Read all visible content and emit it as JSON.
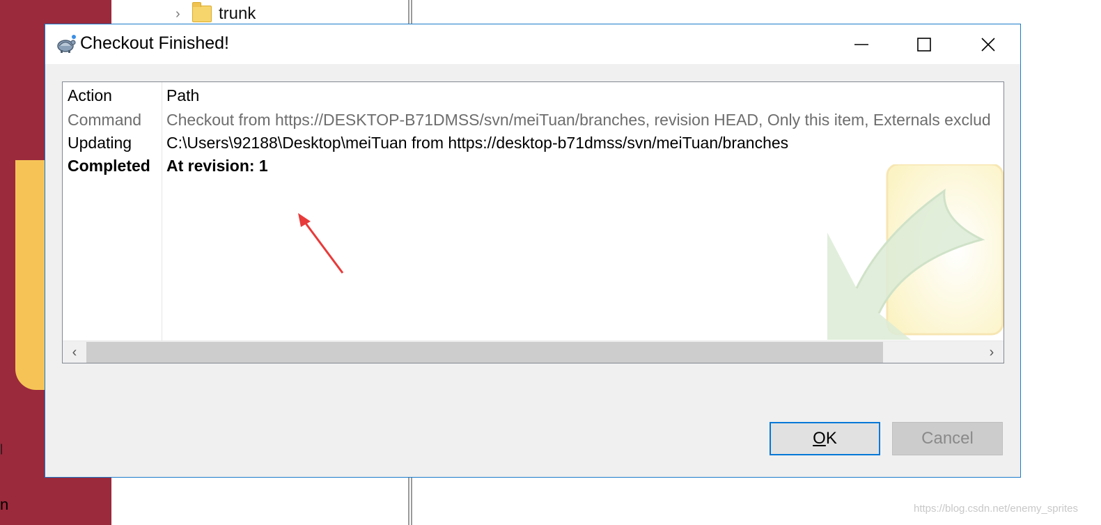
{
  "background": {
    "tree_item": {
      "label": "trunk"
    },
    "left_fragments": {
      "top": "|",
      "bottom": "n"
    }
  },
  "dialog": {
    "title": "Checkout Finished!",
    "icon": "tortoisesvn-icon",
    "window_controls": {
      "minimize": "minimize-icon",
      "maximize": "maximize-icon",
      "close": "close-icon"
    },
    "list": {
      "columns": [
        "Action",
        "Path"
      ],
      "rows": [
        {
          "action": "Command",
          "path": "Checkout from https://DESKTOP-B71DMSS/svn/meiTuan/branches, revision HEAD, Only this item, Externals exclud",
          "style": "dimmed"
        },
        {
          "action": "Updating",
          "path": "C:\\Users\\92188\\Desktop\\meiTuan from https://desktop-b71dmss/svn/meiTuan/branches",
          "style": "normal"
        },
        {
          "action": "Completed",
          "path": "At revision: 1",
          "style": "bold"
        }
      ]
    },
    "buttons": {
      "ok": {
        "prefix": "",
        "mnemonic": "O",
        "rest": "K"
      },
      "cancel": "Cancel"
    }
  },
  "watermark_text": "https://blog.csdn.net/enemy_sprites",
  "colors": {
    "accent": "#0078d7",
    "window_border": "#1979ca",
    "annotation_arrow": "#e83a3a",
    "background_red": "#9a2a3c"
  }
}
